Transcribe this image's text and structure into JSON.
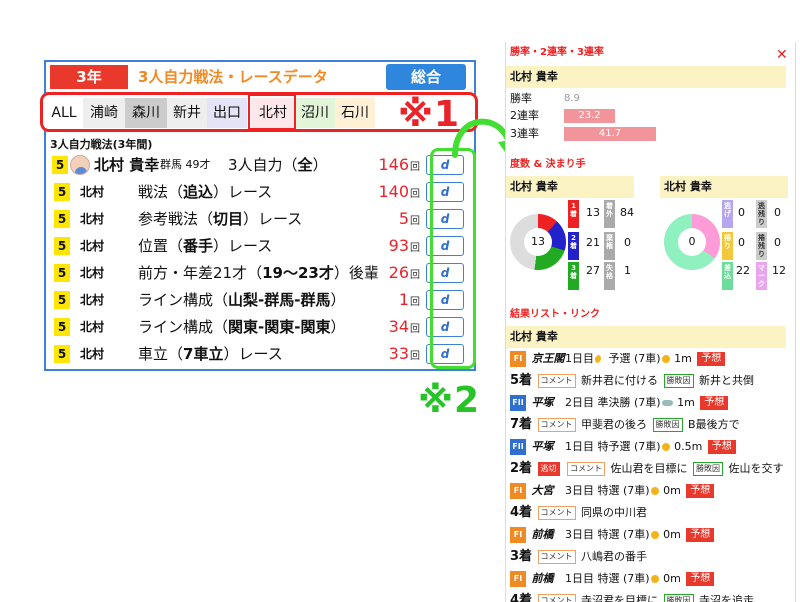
{
  "left": {
    "year_tab": "3年",
    "title": "3人自力戦法・レースデータ",
    "total_button": "総合",
    "tabs": [
      "ALL",
      "浦崎",
      "森川",
      "新井",
      "出口",
      "北村",
      "沼川",
      "石川"
    ],
    "selected_tab": "北村",
    "mark1": "※1",
    "section_title": "3人自力戦法(3年間)",
    "rows": [
      {
        "num": "5",
        "name": "北村 貴幸",
        "meta": "群馬 49才",
        "desc_pre": "3人自力（",
        "desc_bold": "全",
        "desc_post": "）",
        "count": "146",
        "unit": "回",
        "btn": "d"
      },
      {
        "num": "5",
        "name": "北村",
        "desc_pre": "戦法（",
        "desc_bold": "追込",
        "desc_post": "）レース",
        "count": "140",
        "unit": "回",
        "btn": "d"
      },
      {
        "num": "5",
        "name": "北村",
        "desc_pre": "参考戦法（",
        "desc_bold": "切目",
        "desc_post": "）レース",
        "count": "5",
        "unit": "回",
        "btn": "d"
      },
      {
        "num": "5",
        "name": "北村",
        "desc_pre": "位置（",
        "desc_bold": "番手",
        "desc_post": "）レース",
        "count": "93",
        "unit": "回",
        "btn": "d"
      },
      {
        "num": "5",
        "name": "北村",
        "desc_pre": "前方・年差21才（",
        "desc_bold": "19〜23才",
        "desc_post": "）後輩",
        "count": "26",
        "unit": "回",
        "btn": "d"
      },
      {
        "num": "5",
        "name": "北村",
        "desc_pre": "ライン構成（",
        "desc_bold": "山梨-群馬-群馬",
        "desc_post": "）",
        "count": "1",
        "unit": "回",
        "btn": "d"
      },
      {
        "num": "5",
        "name": "北村",
        "desc_pre": "ライン構成（",
        "desc_bold": "関東-関東-関東",
        "desc_post": "）",
        "count": "34",
        "unit": "回",
        "btn": "d"
      },
      {
        "num": "5",
        "name": "北村",
        "desc_pre": "車立（",
        "desc_bold": "7車立",
        "desc_post": "）レース",
        "count": "33",
        "unit": "回",
        "btn": "d"
      }
    ],
    "mark2": "※2"
  },
  "right": {
    "header1": "勝率・2連率・3連率",
    "close": "✕",
    "name": "北村 貴幸",
    "rates": [
      {
        "label": "勝率",
        "value": "8.9",
        "fill": 0.089
      },
      {
        "label": "2連率",
        "value": "23.2",
        "fill": 0.232
      },
      {
        "label": "3連率",
        "value": "41.7",
        "fill": 0.417
      }
    ],
    "header2": "度数 & 決まり手",
    "left_card": {
      "name": "北村 貴幸",
      "center": "13",
      "tags": [
        "1着",
        "2着",
        "3着"
      ],
      "tag_vals": [
        "13",
        "21",
        "27"
      ],
      "tags2": [
        "着外",
        "棄権",
        "失格"
      ],
      "tag2_vals": [
        "84",
        "0",
        "1"
      ]
    },
    "right_card": {
      "name": "北村 貴幸",
      "center": "0",
      "tags": [
        "逃げ",
        "捲り",
        "差込"
      ],
      "tag_vals": [
        "0",
        "0",
        "22"
      ],
      "tags2": [
        "逃残り",
        "捲残り",
        "マーク"
      ],
      "tag2_vals": [
        "0",
        "0",
        "12"
      ]
    },
    "header3": "結果リスト・リンク",
    "name2": "北村 貴幸",
    "entries": [
      {
        "grade": "FI",
        "venue": "京王閣",
        "day": "1日目",
        "race": "予選 (7車)",
        "dist": "1m",
        "rank_tag": "予想"
      },
      {
        "pos": "5着",
        "comment": "新井君に付ける",
        "winfactor": "新井と共倒"
      },
      {
        "grade": "FII",
        "venue": "平塚",
        "day": "2日目",
        "race": "準決勝 (7車)",
        "dist": "1m",
        "rank_tag": "予想"
      },
      {
        "pos": "7着",
        "comment": "甲斐君の後ろ",
        "winfactor": "B最後方で"
      },
      {
        "grade": "FII",
        "venue": "平塚",
        "day": "1日目",
        "race": "特予選 (7車)",
        "dist": "0.5m",
        "rank_tag": "予想"
      },
      {
        "pos": "2着",
        "tag": "逃切",
        "comment": "佐山君を目標に",
        "winfactor": "佐山を交す"
      },
      {
        "grade": "FI",
        "venue": "大宮",
        "day": "3日目",
        "race": "特選 (7車)",
        "dist": "0m",
        "rank_tag": "予想"
      },
      {
        "pos": "4着",
        "comment": "同県の中川君"
      },
      {
        "grade": "FI",
        "venue": "前橋",
        "day": "3日目",
        "race": "特選 (7車)",
        "dist": "0m",
        "rank_tag": "予想"
      },
      {
        "pos": "3着",
        "comment": "八嶋君の番手"
      },
      {
        "grade": "FI",
        "venue": "前橋",
        "day": "1日目",
        "race": "特選 (7車)",
        "dist": "0m",
        "rank_tag": "予想"
      },
      {
        "pos": "4着",
        "comment": "寺沼君を目標に",
        "winfactor": "寺沼を追走"
      }
    ]
  },
  "colors": {
    "red": "#e8242a",
    "blue": "#3b82d8",
    "green": "#44dd33",
    "orange": "#f08a24",
    "yellow": "#ffe600"
  }
}
